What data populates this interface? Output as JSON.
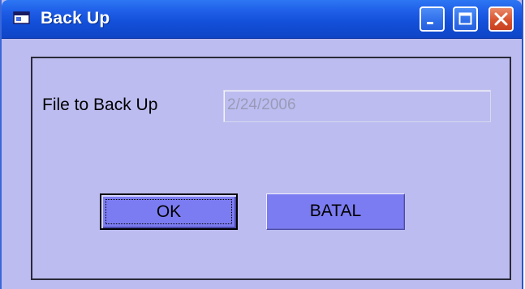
{
  "window": {
    "title": "Back Up",
    "icon": "app-window-icon",
    "controls": {
      "minimize_icon": "minimize-icon",
      "maximize_icon": "maximize-icon",
      "close_icon": "close-icon"
    }
  },
  "form": {
    "file_label": "File to Back Up",
    "file_value": "2/24/2006"
  },
  "buttons": {
    "ok_label": "OK",
    "cancel_label": "BATAL"
  },
  "colors": {
    "titlebar": "#1f5ee8",
    "window_bg": "#bcbcf0",
    "button_bg": "#7c7cf2",
    "close_button": "#d9532e"
  }
}
